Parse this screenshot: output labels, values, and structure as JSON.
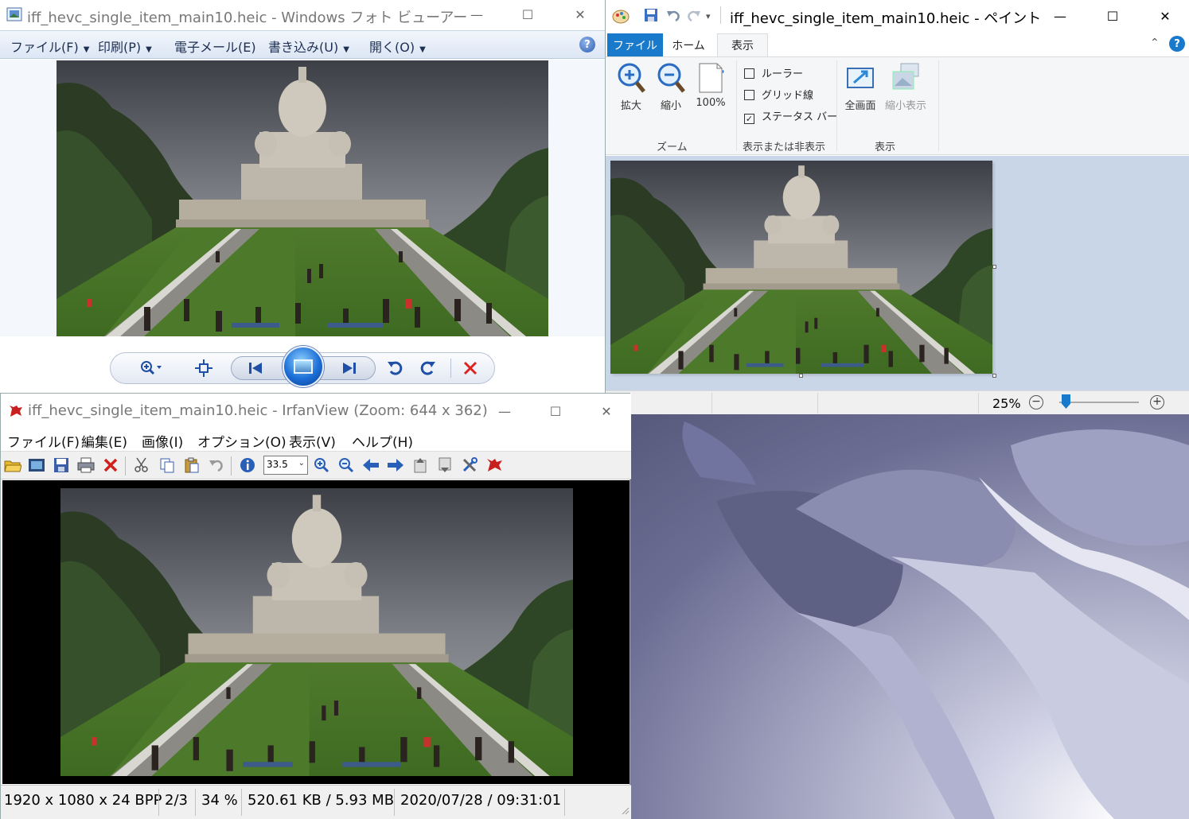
{
  "colors": {
    "paint_accent": "#1979ca",
    "photo_viewer_menubar": "#dce6f4",
    "irfan_canvas": "#000000",
    "delete_red": "#dd2222"
  },
  "photo_viewer": {
    "title": "iff_hevc_single_item_main10.heic - Windows フォト ビューアー",
    "menu": [
      {
        "label": "ファイル(F)"
      },
      {
        "label": "印刷(P)"
      },
      {
        "label": "電子メール(E)"
      },
      {
        "label": "書き込み(U)"
      },
      {
        "label": "開く(O)"
      }
    ],
    "help_icon": "?",
    "controls": {
      "zoom_icon": "magnifier-plus-icon",
      "fit_icon": "actual-size-icon",
      "prev_icon": "skip-previous-icon",
      "slideshow_icon": "slideshow-icon",
      "next_icon": "skip-next-icon",
      "rotate_ccw_icon": "rotate-left-icon",
      "rotate_cw_icon": "rotate-right-icon",
      "delete_icon": "close-x-icon"
    }
  },
  "paint": {
    "title": "iff_hevc_single_item_main10.heic - ペイント",
    "tabs": [
      {
        "label": "ファイル"
      },
      {
        "label": "ホーム"
      },
      {
        "label": "表示"
      }
    ],
    "active_tab": "表示",
    "help_icon": "?",
    "ribbon": {
      "zoom_in": "拡大",
      "zoom_out": "縮小",
      "zoom_100": "100%",
      "zoom_group": "ズーム",
      "ruler": "ルーラー",
      "gridlines": "グリッド線",
      "statusbar": "ステータス バー",
      "show_hide_group": "表示または非表示",
      "fullscreen": "全画面",
      "thumbnail": "縮小表示",
      "display_group": "表示"
    },
    "checkboxes": {
      "ruler": false,
      "gridlines": false,
      "statusbar": true
    },
    "status": {
      "zoom_text": "25%",
      "zoom_fraction": 0.08
    }
  },
  "irfan": {
    "title": "iff_hevc_single_item_main10.heic - IrfanView (Zoom: 644 x 362)",
    "menu": [
      {
        "label": "ファイル(F)"
      },
      {
        "label": "編集(E)"
      },
      {
        "label": "画像(I)"
      },
      {
        "label": "オプション(O)"
      },
      {
        "label": "表示(V)"
      },
      {
        "label": "ヘルプ(H)"
      }
    ],
    "zoom_value": "33.5",
    "status": {
      "dimensions": "1920 x 1080 x 24 BPP",
      "index": "2/3",
      "zoom": "34 %",
      "size": "520.61 KB / 5.93 MB",
      "datetime": "2020/07/28 / 09:31:01"
    }
  }
}
